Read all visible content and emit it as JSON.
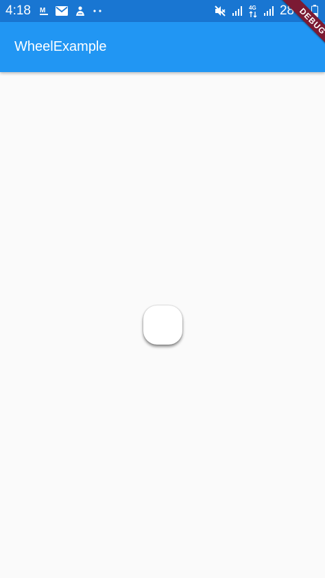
{
  "status_bar": {
    "time": "4:18",
    "battery_percent": "28%",
    "network_type": "4G",
    "icons": [
      "m-logo-icon",
      "mail-icon",
      "app-icon",
      "more-dots-icon",
      "mute-icon",
      "signal-icon",
      "data-arrows-icon",
      "signal-icon",
      "battery-icon"
    ]
  },
  "app_bar": {
    "title": "WheelExample"
  },
  "debug_banner": {
    "label": "DEBUG"
  },
  "colors": {
    "status_bar": "#1976d2",
    "app_bar": "#2196f3",
    "background": "#fafafa",
    "debug_banner": "#7b1a33",
    "knob": "#ffffff"
  }
}
